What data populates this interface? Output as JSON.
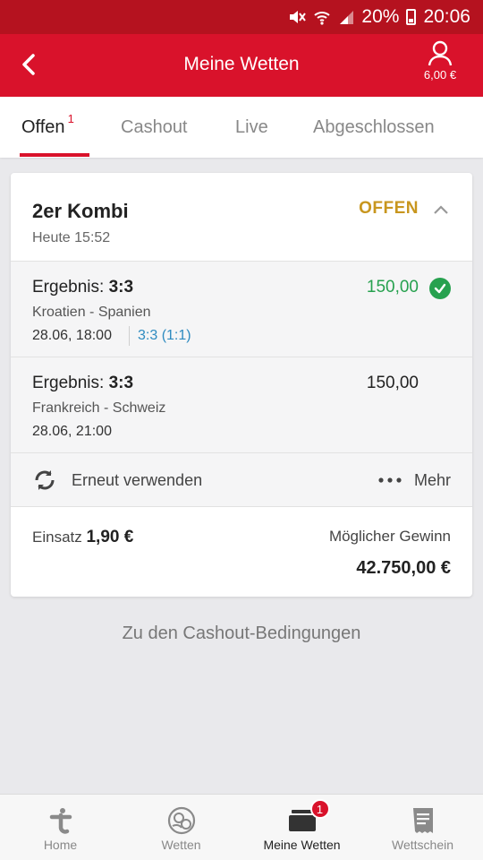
{
  "status_bar": {
    "battery": "20%",
    "time": "20:06"
  },
  "header": {
    "title": "Meine Wetten",
    "balance": "6,00 €"
  },
  "tabs": [
    {
      "label": "Offen",
      "badge": "1",
      "active": true
    },
    {
      "label": "Cashout"
    },
    {
      "label": "Live"
    },
    {
      "label": "Abgeschlossen"
    }
  ],
  "bet": {
    "type": "2er Kombi",
    "time": "Heute 15:52",
    "status": "OFFEN",
    "selections": [
      {
        "market_label": "Ergebnis:",
        "market_value": "3:3",
        "odds": "150,00",
        "won": true,
        "match": "Kroatien - Spanien",
        "date": "28.06, 18:00",
        "result": "3:3 (1:1)"
      },
      {
        "market_label": "Ergebnis:",
        "market_value": "3:3",
        "odds": "150,00",
        "won": false,
        "match": "Frankreich - Schweiz",
        "date": "28.06, 21:00",
        "result": ""
      }
    ],
    "reuse_label": "Erneut verwenden",
    "more_label": "Mehr",
    "stake_label": "Einsatz",
    "stake_value": "1,90 €",
    "win_label": "Möglicher Gewinn",
    "win_value": "42.750,00 €"
  },
  "conditions_link": "Zu den Cashout-Bedingungen",
  "bottom_nav": [
    {
      "label": "Home",
      "icon": "tipico-logo-icon"
    },
    {
      "label": "Wetten",
      "icon": "sports-ball-icon"
    },
    {
      "label": "Meine Wetten",
      "icon": "bet-slip-stack-icon",
      "badge": "1",
      "active": true
    },
    {
      "label": "Wettschein",
      "icon": "receipt-icon"
    }
  ],
  "colors": {
    "brand_red": "#d9122b",
    "status_bar_red": "#b5121f",
    "open_gold": "#c8961e",
    "win_green": "#27a14f",
    "result_blue": "#2e8bc0"
  }
}
